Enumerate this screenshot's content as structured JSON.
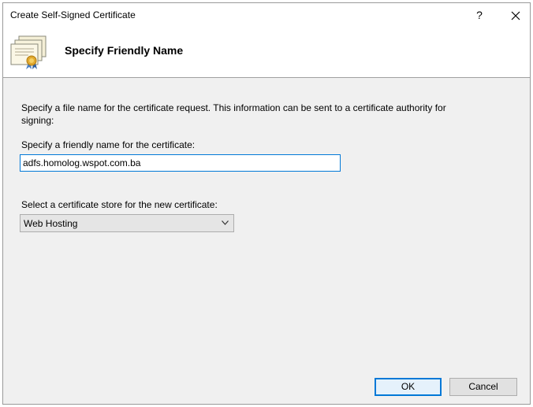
{
  "window": {
    "title": "Create Self-Signed Certificate",
    "help_label": "?"
  },
  "header": {
    "title": "Specify Friendly Name"
  },
  "form": {
    "description": "Specify a file name for the certificate request.  This information can be sent to a certificate authority for signing:",
    "friendly_name_label": "Specify a friendly name for the certificate:",
    "friendly_name_value": "adfs.homolog.wspot.com.ba",
    "store_label": "Select a certificate store for the new certificate:",
    "store_value": "Web Hosting"
  },
  "buttons": {
    "ok_label": "OK",
    "cancel_label": "Cancel"
  },
  "colors": {
    "accent": "#0078d7",
    "content_bg": "#f0f0f0"
  }
}
